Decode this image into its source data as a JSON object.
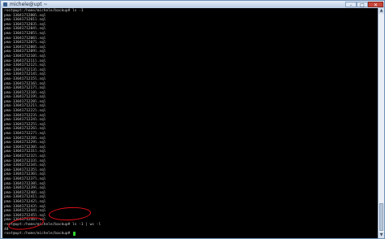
{
  "window": {
    "title": "michele@upt ~"
  },
  "window_controls": {
    "minimize": "–",
    "maximize": "□",
    "close": "✕"
  },
  "scrollbar": {
    "up_arrow": "▲",
    "down_arrow": "▼"
  },
  "terminal": {
    "lines": [
      "root@upt:/home/michele/backup# ls -1",
      "pma-1304171200l.sql",
      "pma-1304171201l.sql",
      "pma-1304171203l.sql",
      "pma-1304171204l.sql",
      "pma-1304171205l.sql",
      "pma-1304171206l.sql",
      "pma-1304171207l.sql",
      "pma-1304171208l.sql",
      "pma-1304171209l.sql",
      "pma-1304171210l.sql",
      "pma-1304171211l.sql",
      "pma-1304171212l.sql",
      "pma-1304171213l.sql",
      "pma-1304171214l.sql",
      "pma-1304171215l.sql",
      "pma-1304171216l.sql",
      "pma-1304171217l.sql",
      "pma-1304171218l.sql",
      "pma-1304171219l.sql",
      "pma-1304171220l.sql",
      "pma-1304171221l.sql",
      "pma-1304171222l.sql",
      "pma-1304171223l.sql",
      "pma-1304171224l.sql",
      "pma-1304171225l.sql",
      "pma-1304171226l.sql",
      "pma-1304171227l.sql",
      "pma-1304171228l.sql",
      "pma-1304171229l.sql",
      "pma-1304171230l.sql",
      "pma-1304171231l.sql",
      "pma-1304171232l.sql",
      "pma-1304171233l.sql",
      "pma-1304171234l.sql",
      "pma-1304171235l.sql",
      "pma-1304171236l.sql",
      "pma-1304171237l.sql",
      "pma-1304171238l.sql",
      "pma-1304171239l.sql",
      "pma-1304171240l.sql",
      "pma-1304171241l.sql",
      "pma-1304171242l.sql",
      "pma-1304171243l.sql",
      "pma-1304171244l.sql",
      "pma-1304171245l.sql",
      "pma-1304171246l.sql",
      "root@upt:/home/michele/backup# ls -1 | wc -l",
      "48"
    ],
    "prompt": "root@upt:/home/michele/backup# ",
    "cursor_color": "#2fd12f"
  },
  "annotations": {
    "color": "#e3101a"
  }
}
